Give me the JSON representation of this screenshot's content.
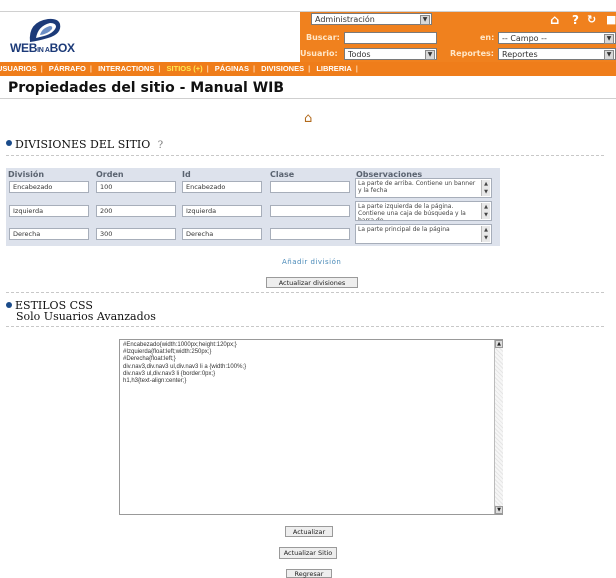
{
  "header": {
    "logo_text": "WEB",
    "logo_small": "IN A",
    "logo_text2": "BOX",
    "admin_select": "Administración",
    "buscar_label": "Buscar:",
    "en_label": "en:",
    "campo_select": "-- Campo --",
    "usuario_label": "Usuario:",
    "usuario_select": "Todos",
    "reportes_label": "Reportes:",
    "reportes_select": "Reportes",
    "icons": [
      "home-icon",
      "help-icon",
      "refresh-icon",
      "logout-icon"
    ]
  },
  "nav": {
    "items": [
      "USUARIOS",
      "PÁRRAFO",
      "INTERACTIONS",
      "SITIOS (+)",
      "PÁGINAS",
      "DIVISIONES",
      "LIBRERIA"
    ],
    "active": "SITIOS (+)"
  },
  "page": {
    "title": "Propiedades del sitio - Manual WIB"
  },
  "divisiones": {
    "heading": "DIVISIONES DEL SITIO",
    "help": "?",
    "headers": [
      "División",
      "Orden",
      "Id",
      "Clase",
      "Observaciones"
    ],
    "rows": [
      {
        "division": "Encabezado",
        "orden": "100",
        "id": "Encabezado",
        "clase": "",
        "obs": "La parte de arriba. Contiene un banner y la fecha"
      },
      {
        "division": "Izquierda",
        "orden": "200",
        "id": "Izquierda",
        "clase": "",
        "obs": "La parte izquierda de la página. Contiene una caja de búsqueda y la barra de"
      },
      {
        "division": "Derecha",
        "orden": "300",
        "id": "Derecha",
        "clase": "",
        "obs": "La parte principal de la página"
      }
    ],
    "add_link": "Añadir división",
    "update_button": "Actualizar divisiones"
  },
  "estilos": {
    "heading": "ESTILOS CSS",
    "subheading": "Solo Usuarios Avanzados",
    "css_text": "#Encabezado{width:1000px;height:120px;}\n#Izquierda{float:left;width:250px;}\n#Derecha{float:left;}\ndiv.nav3,div.nav3 ul,div.nav3 li a {width:100%;}\ndiv.nav3 ul,div.nav3 li {border:0px;}\nh1,h3{text-align:center;}",
    "update_button": "Actualizar"
  },
  "footer": {
    "update_site_button": "Actualizar Sitio",
    "back_button": "Regresar"
  }
}
